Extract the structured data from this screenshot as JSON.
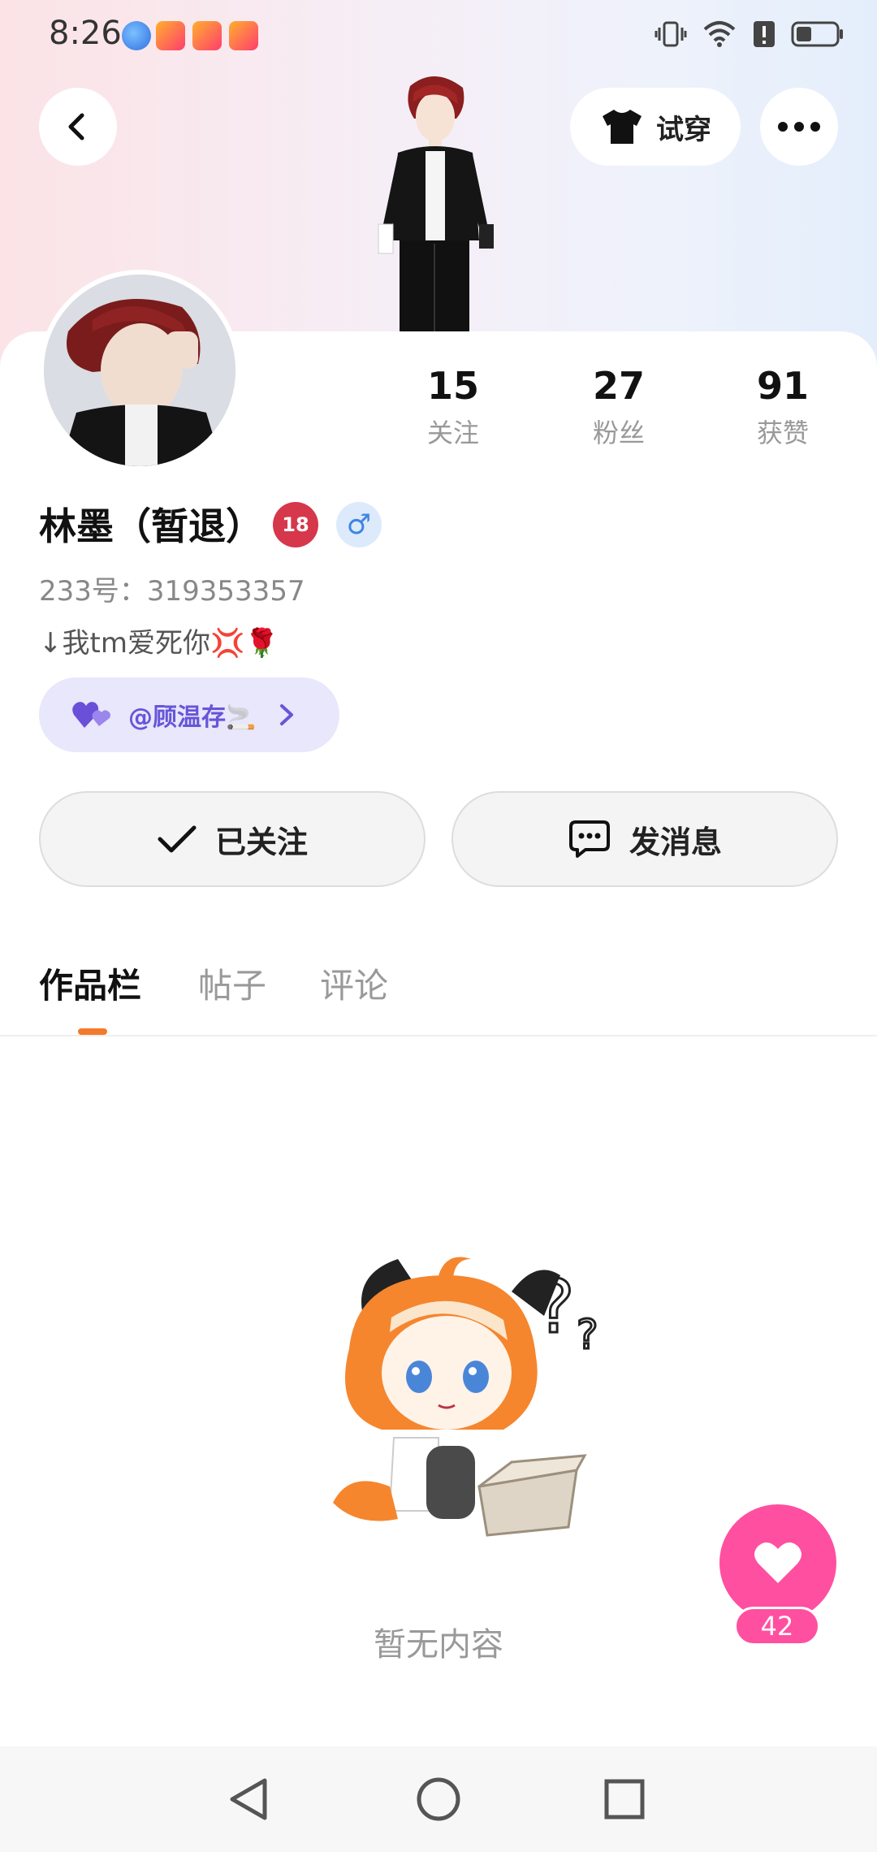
{
  "status_bar": {
    "time": "8:26",
    "apps": [
      {
        "name": "browser-icon",
        "color": "#2f8cff"
      },
      {
        "name": "kuaishou-icon",
        "color": "#ff6a2a"
      },
      {
        "name": "kuaishou-icon",
        "color": "#ff6a2a"
      },
      {
        "name": "kuaishou-icon",
        "color": "#ff6a2a"
      }
    ],
    "battery_level": 0.4
  },
  "header": {
    "try_on_label": "试穿"
  },
  "profile": {
    "stats": [
      {
        "value": "15",
        "label": "关注"
      },
      {
        "value": "27",
        "label": "粉丝"
      },
      {
        "value": "91",
        "label": "获赞"
      }
    ],
    "nickname": "林墨（暂退）",
    "age_badge": "18",
    "gender_symbol": "♂",
    "uid": "233号：319353357",
    "bio": "↓我tm爱死你💢🌹",
    "relation": {
      "text": "@顾温存🚬"
    }
  },
  "actions": {
    "follow_label": "已关注",
    "message_label": "发消息"
  },
  "tabs": [
    {
      "label": "作品栏",
      "active": true
    },
    {
      "label": "帖子",
      "active": false
    },
    {
      "label": "评论",
      "active": false
    }
  ],
  "empty_state": {
    "text": "暂无内容"
  },
  "fab": {
    "count": "42",
    "color": "#ff4fa0"
  },
  "colors": {
    "accent_tab": "#f47a2b",
    "relation_text": "#6656d8",
    "relation_bg": "#e8e7fb"
  }
}
